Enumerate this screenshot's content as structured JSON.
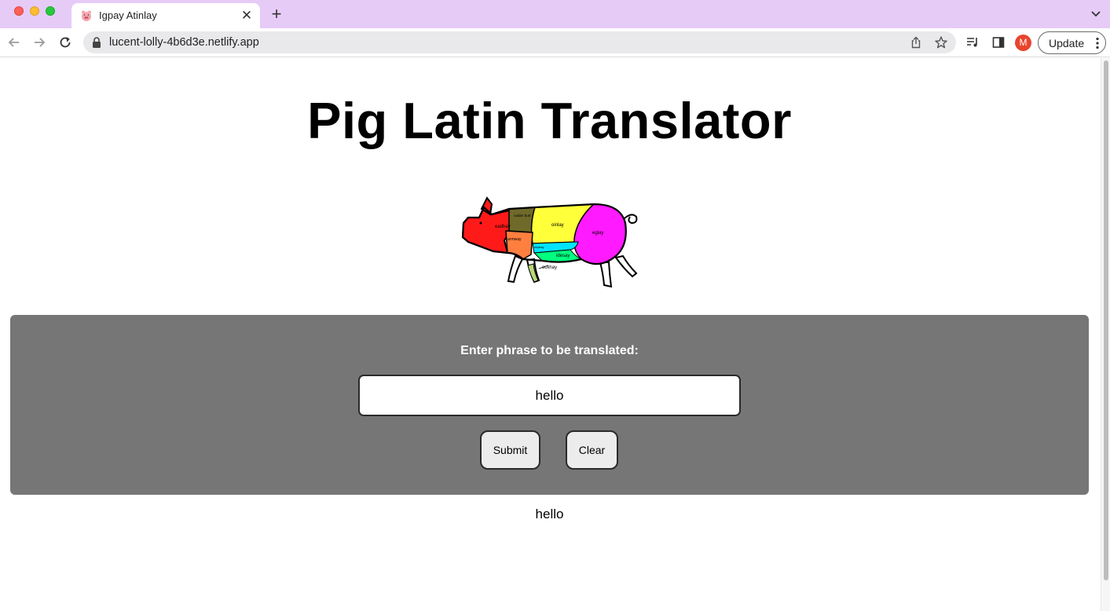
{
  "browser": {
    "tab_title": "Igpay Atinlay",
    "url": "lucent-lolly-4b6d3e.netlify.app",
    "profile_initial": "M",
    "update_label": "Update"
  },
  "page": {
    "title": "Pig Latin Translator",
    "pig_labels": {
      "head": "eadhay",
      "shoulder": "oulder butt",
      "loin": "oinlay",
      "leg": "eglay",
      "arm": "armway",
      "belly": "ellybay",
      "sides": "idesay",
      "hock": "ockhay"
    },
    "prompt": "Enter phrase to be translated:",
    "input_value": "hello",
    "submit_label": "Submit",
    "clear_label": "Clear",
    "output": "hello"
  },
  "colors": {
    "chrome_titlebar": "#e6cbf7",
    "panel": "#767676",
    "avatar": "#e8442d"
  }
}
